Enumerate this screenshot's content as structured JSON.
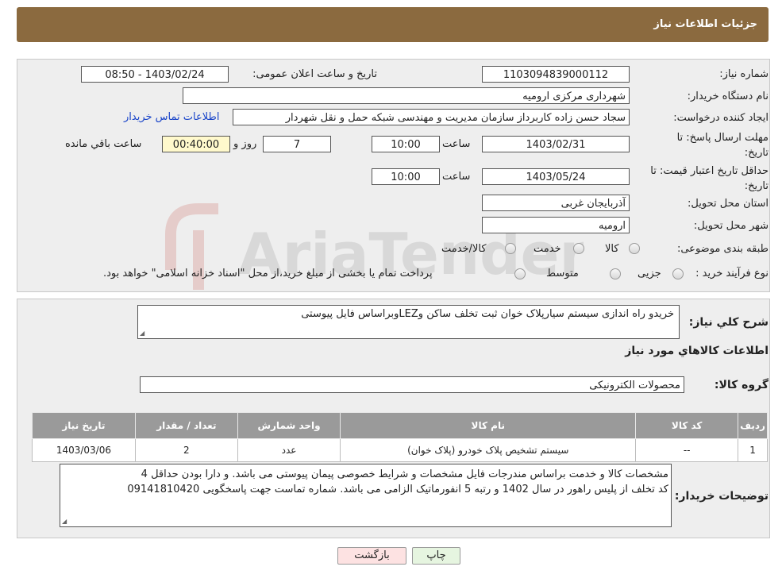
{
  "header": {
    "title": "جزئیات اطلاعات نیاز"
  },
  "form": {
    "need_number": {
      "label": "شماره نیاز:",
      "value": "1103094839000112"
    },
    "announce": {
      "label": "تاریخ و ساعت اعلان عمومی:",
      "value": "1403/02/24 - 08:50"
    },
    "buyer": {
      "label": "نام دستگاه خریدار:",
      "value": "شهرداری مرکزی ارومیه"
    },
    "creator": {
      "label": "ایجاد کننده درخواست:",
      "value": "سجاد حسن زاده کاربرداز سازمان مدیریت و مهندسی شبکه حمل و نقل شهردار",
      "link": "اطلاعات تماس خریدار"
    },
    "deadline": {
      "label": "مهلت ارسال پاسخ: تا تاریخ:",
      "date": "1403/02/31",
      "time_label": "ساعت",
      "time": "10:00",
      "days": "7",
      "days_label": "روز و",
      "remaining": "00:40:00",
      "remaining_label": "ساعت باقي مانده"
    },
    "validity": {
      "label": "حداقل تاریخ اعتبار قیمت: تا تاریخ:",
      "date": "1403/05/24",
      "time_label": "ساعت",
      "time": "10:00"
    },
    "province": {
      "label": "استان محل تحویل:",
      "value": "آذربایجان غربی"
    },
    "city": {
      "label": "شهر محل تحویل:",
      "value": "ارومیه"
    },
    "category": {
      "label": "طبقه بندی موضوعی:",
      "options": [
        "کالا",
        "خدمت",
        "کالا/خدمت"
      ]
    },
    "process": {
      "label": "نوع فرآیند خرید :",
      "options": [
        "جزیی",
        "متوسط"
      ],
      "note": "پرداخت تمام یا بخشی از مبلغ خرید،از محل \"اسناد خزانه اسلامی\" خواهد بود."
    }
  },
  "details": {
    "desc_label": "شرح کلي نياز:",
    "desc_value": "خریدو راه اندازی سیستم سیارپلاک خوان ثبت تخلف ساکن وLEZوبراساس فایل پیوستی",
    "goods_title": "اطلاعات کالاهاي مورد نياز",
    "group_label": "گروه کالا:",
    "group_value": "محصولات الکترونیکی",
    "table": {
      "headers": [
        "ردیف",
        "کد کالا",
        "نام کالا",
        "واحد شمارش",
        "تعداد / مقدار",
        "تاریخ نیاز"
      ],
      "rows": [
        [
          "1",
          "--",
          "سیستم تشخیص پلاک خودرو (پلاک خوان)",
          "عدد",
          "2",
          "1403/03/06"
        ]
      ]
    },
    "buyer_notes_label": "توضیحات خریدار:",
    "buyer_notes_line1": "مشخصات کالا و خدمت براساس مندرجات فایل مشخصات و شرایط خصوصی پیمان پیوستی می باشد. و دارا بودن حداقل 4",
    "buyer_notes_line2": "کد تخلف از پلیس راهور در سال 1402 و رتبه 5 انفورماتیک الزامی می باشد. شماره تماست جهت پاسخگویی 09141810420"
  },
  "buttons": {
    "print": "چاپ",
    "back": "بازگشت"
  },
  "watermark": {
    "text": "AriaTender.neT"
  },
  "colors": {
    "header": "#8b6a3f",
    "link": "#1a45c9",
    "back_button": "#fde2e2",
    "print_button": "#e6f5e0",
    "remaining_box": "#fff9cc"
  }
}
